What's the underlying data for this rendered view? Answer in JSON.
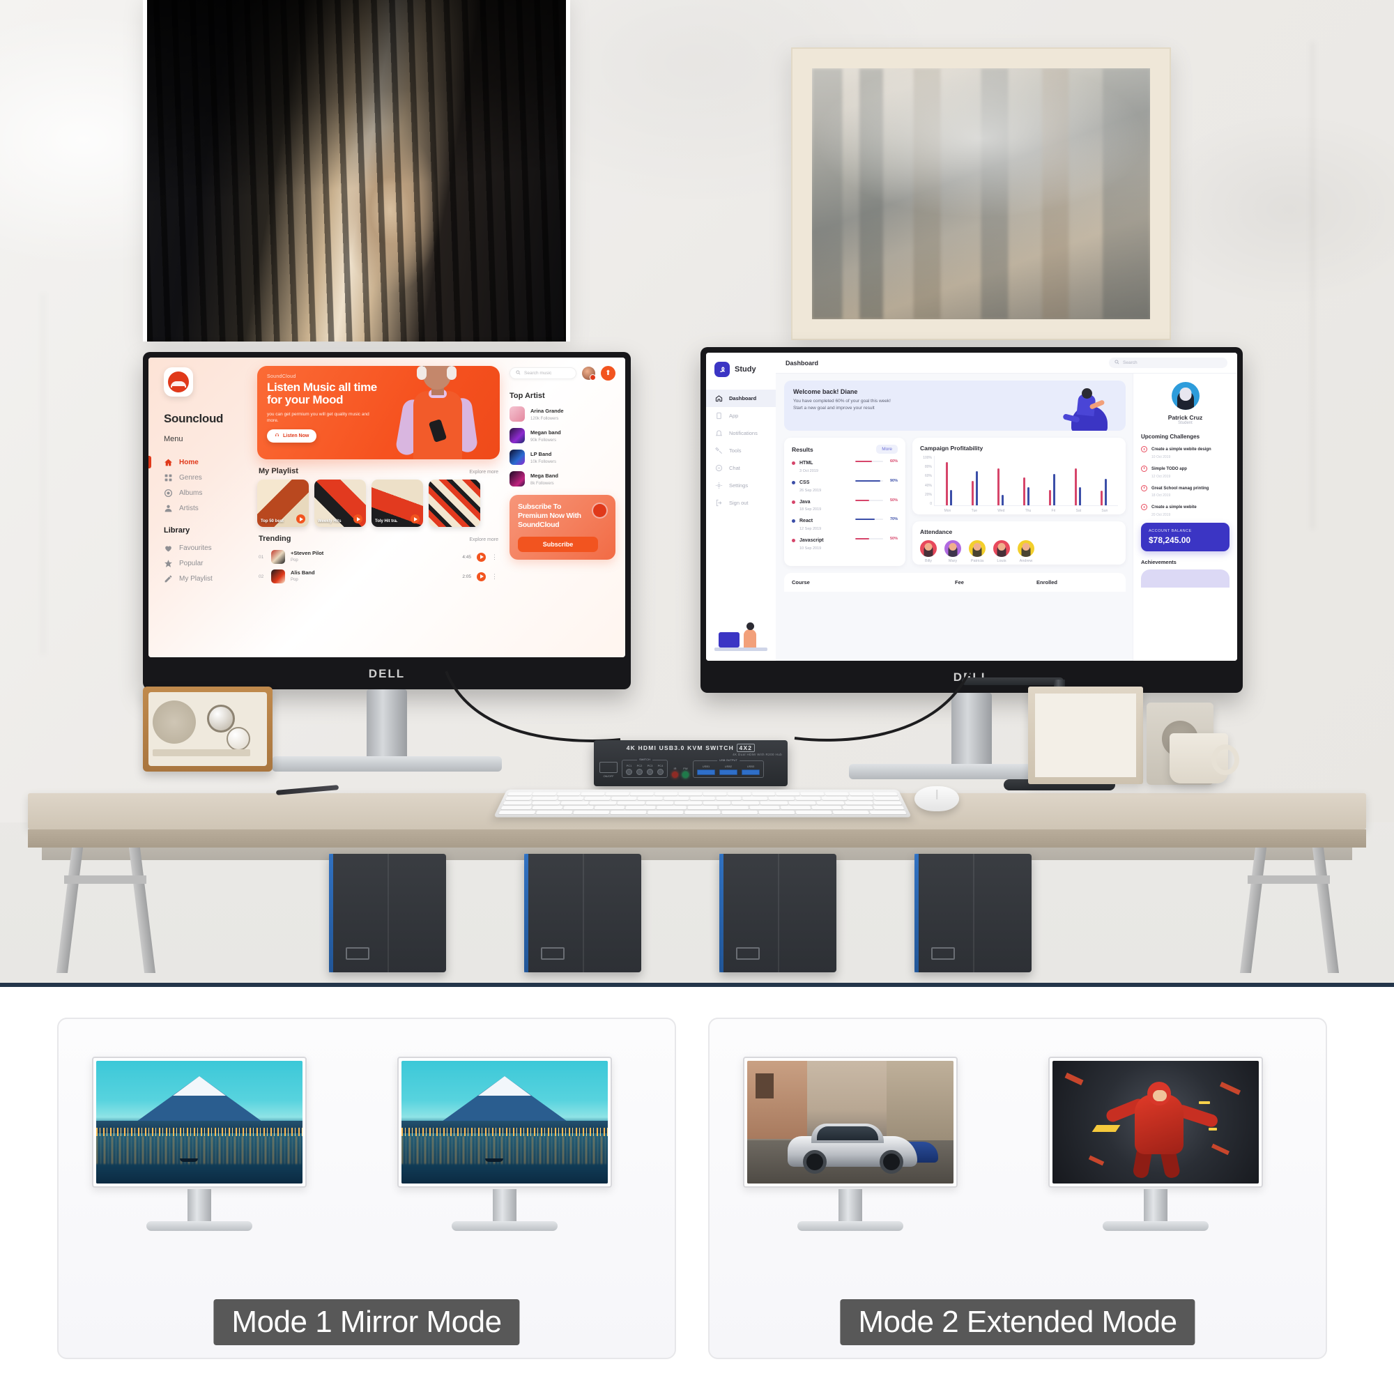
{
  "scene": {
    "soundcloud": {
      "brand": "Souncloud",
      "menu_label": "Menu",
      "nav": [
        {
          "label": "Home",
          "icon": "home-icon",
          "active": true
        },
        {
          "label": "Genres",
          "icon": "grid-icon",
          "active": false
        },
        {
          "label": "Albums",
          "icon": "disc-icon",
          "active": false
        },
        {
          "label": "Artists",
          "icon": "person-icon",
          "active": false
        }
      ],
      "library_label": "Library",
      "library": [
        {
          "label": "Favourites",
          "icon": "heart-icon"
        },
        {
          "label": "Popular",
          "icon": "star-icon"
        },
        {
          "label": "My Playlist",
          "icon": "pencil-icon"
        }
      ],
      "hero": {
        "brand": "SoundCloud",
        "headline": "Listen Music all time for your Mood",
        "body": "you can get permium you will get quality music and more.",
        "button": "Listen Now"
      },
      "search_placeholder": "Search music",
      "playlist": {
        "title": "My Playlist",
        "explore": "Explore more",
        "cards": [
          {
            "label": "Top 50 best"
          },
          {
            "label": "Weekly Hits"
          },
          {
            "label": "Toly Hit tra."
          },
          {
            "label": ""
          }
        ]
      },
      "trending": {
        "title": "Trending",
        "explore": "Explore more",
        "rows": [
          {
            "no": "01",
            "name": "+Steven Pilot",
            "sub": "Pop",
            "time": "4:45"
          },
          {
            "no": "02",
            "name": "Alis Band",
            "sub": "Pop",
            "time": "2:05"
          }
        ]
      },
      "top_artist": {
        "title": "Top Artist",
        "items": [
          {
            "name": "Arina Grande",
            "followers": "120k Followers"
          },
          {
            "name": "Megan band",
            "followers": "90k Followers"
          },
          {
            "name": "LP Band",
            "followers": "10k Followers"
          },
          {
            "name": "Mega Band",
            "followers": "8k Followers"
          }
        ]
      },
      "promo": {
        "headline": "Subscribe To Premium Now With SoundCloud",
        "button": "Subscribe"
      }
    },
    "study": {
      "brand": "Study",
      "nav": [
        {
          "label": "Dashboard",
          "icon": "home-icon",
          "active": true
        },
        {
          "label": "App",
          "icon": "app-icon",
          "active": false
        },
        {
          "label": "Notifications",
          "icon": "bell-icon",
          "active": false
        },
        {
          "label": "Tools",
          "icon": "tools-icon",
          "active": false
        },
        {
          "label": "Chat",
          "icon": "chat-icon",
          "active": false
        },
        {
          "label": "Settings",
          "icon": "gear-icon",
          "active": false
        },
        {
          "label": "Sign out",
          "icon": "signout-icon",
          "active": false
        }
      ],
      "topbar": {
        "title": "Dashboard",
        "search_placeholder": "Search"
      },
      "welcome": {
        "title": "Welcome back! Diane",
        "line1": "You have completed 60% of your goal this week!",
        "line2": "Start a new goal and improve your result"
      },
      "results": {
        "title": "Results",
        "more": "More",
        "rows": [
          {
            "name": "HTML",
            "date": "3 Oct 2019",
            "pct": "60%",
            "value": 60,
            "color": "#d6456a"
          },
          {
            "name": "CSS",
            "date": "26 Sep 2019",
            "pct": "90%",
            "value": 90,
            "color": "#3b4ea8"
          },
          {
            "name": "Java",
            "date": "18 Sep 2019",
            "pct": "50%",
            "value": 50,
            "color": "#d6456a"
          },
          {
            "name": "React",
            "date": "12 Sep 2019",
            "pct": "70%",
            "value": 70,
            "color": "#3b4ea8"
          },
          {
            "name": "Javascript",
            "date": "10 Sep 2019",
            "pct": "50%",
            "value": 50,
            "color": "#d6456a"
          }
        ]
      },
      "attendance": {
        "title": "Attendance",
        "people": [
          "Billy",
          "Mary",
          "Patricia",
          "Louis",
          "Andrew"
        ]
      },
      "table_headers": [
        "Course",
        "Fee",
        "Enrolled"
      ],
      "profile": {
        "name": "Patrick Cruz",
        "role": "Student",
        "challenges_title": "Upcoming Challenges",
        "challenges": [
          {
            "title": "Create a simple webite design",
            "date": "10 Oct 2019"
          },
          {
            "title": "Simple TODO app",
            "date": "12 Oct 2019"
          },
          {
            "title": "Great School manag printing",
            "date": "18 Oct 2019"
          },
          {
            "title": "Create a simple webite",
            "date": "20 Oct 2019"
          }
        ],
        "balance_label": "ACCOUNT BALANCE",
        "balance_value": "$78,245.00",
        "achievements_title": "Achievements"
      }
    },
    "monitor_brand": "DELL",
    "kvm": {
      "title_main": "4K HDMI USB3.0 KVM SWITCH",
      "title_box": "4X2",
      "subtitle": "4K Dual HDMI With R200 Hub",
      "power_label": "ON/OFF",
      "switch_group": "SWITCH",
      "switch_buttons": [
        "PC1",
        "PC2",
        "PC3",
        "PC4"
      ],
      "led_labels": [
        "IR",
        "PW"
      ],
      "usb_group": "USB OUTPUT",
      "usb_ports": [
        "USB1",
        "USB2",
        "USB3"
      ]
    }
  },
  "chart_data": {
    "type": "bar",
    "title": "Campaign Profitability",
    "categories": [
      "Mon",
      "Tue",
      "Wed",
      "Thu",
      "Fri",
      "Sat",
      "Sun"
    ],
    "series": [
      {
        "name": "Series A",
        "color": "#d6456a",
        "values": [
          88,
          50,
          75,
          57,
          31,
          74,
          29
        ]
      },
      {
        "name": "Series B",
        "color": "#3b4ea8",
        "values": [
          31,
          69,
          21,
          37,
          63,
          37,
          54
        ]
      }
    ],
    "ylabel": "",
    "xlabel": "",
    "ylim": [
      0,
      100
    ],
    "yticks": [
      "100%",
      "80%",
      "60%",
      "40%",
      "20%",
      "0"
    ],
    "grid": false,
    "legend": "none"
  },
  "modes": {
    "left": {
      "label": "Mode 1 Mirror Mode"
    },
    "right": {
      "label": "Mode 2 Extended Mode"
    }
  }
}
